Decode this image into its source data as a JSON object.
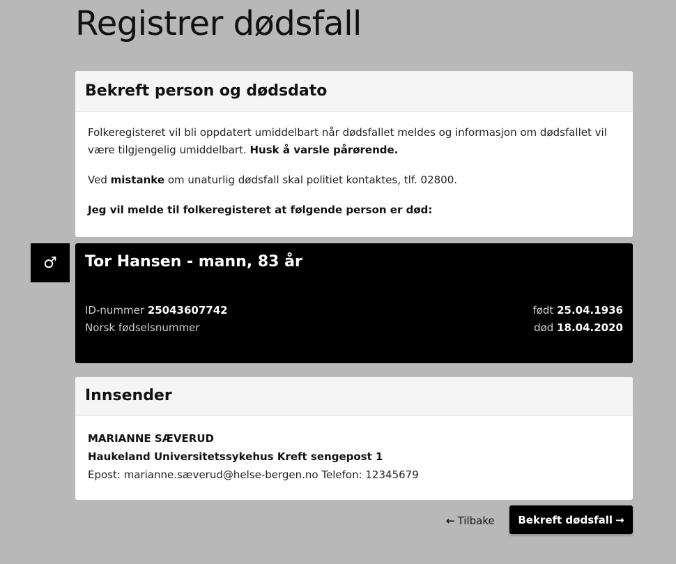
{
  "page": {
    "title": "Registrer dødsfall"
  },
  "confirm_section": {
    "header": "Bekreft person og dødsdato",
    "paragraph1_text": "Folkeregisteret vil bli oppdatert umiddelbart når dødsfallet meldes og informasjon om dødsfallet vil være tilgjengelig umiddelbart.",
    "paragraph1_bold": "Husk å varsle pårørende.",
    "paragraph2_prefix": "Ved",
    "paragraph2_bold": "mistanke",
    "paragraph2_suffix": "om unaturlig dødsfall skal politiet kontaktes, tlf. 02800.",
    "paragraph3_bold": "Jeg vil melde til folkeregisteret at følgende person er død:"
  },
  "person": {
    "gender_symbol": "♂",
    "name_line": "Tor Hansen - mann, 83 år",
    "id_label": "ID-nummer",
    "id_value": "25043607742",
    "id_type": "Norsk fødselsnummer",
    "born_label": "født",
    "born_value": "25.04.1936",
    "died_label": "død",
    "died_value": "18.04.2020"
  },
  "sender": {
    "header": "Innsender",
    "name": "MARIANNE SÆVERUD",
    "organization": "Haukeland Universitetssykehus Kreft sengepost 1",
    "contact": "Epost: marianne.sæverud@helse-bergen.no Telefon: 12345679"
  },
  "actions": {
    "back_arrow": "←",
    "back_label": "Tilbake",
    "confirm_label": "Bekreft dødsfall",
    "confirm_arrow": "→"
  },
  "colors": {
    "background": "#b8b8b8",
    "card": "#ffffff",
    "card_header": "#f5f5f5",
    "person_card": "#000000",
    "primary_button": "#000000"
  },
  "icons": {
    "gender": "male-symbol-icon",
    "back": "arrow-left-icon",
    "confirm": "arrow-right-icon"
  }
}
